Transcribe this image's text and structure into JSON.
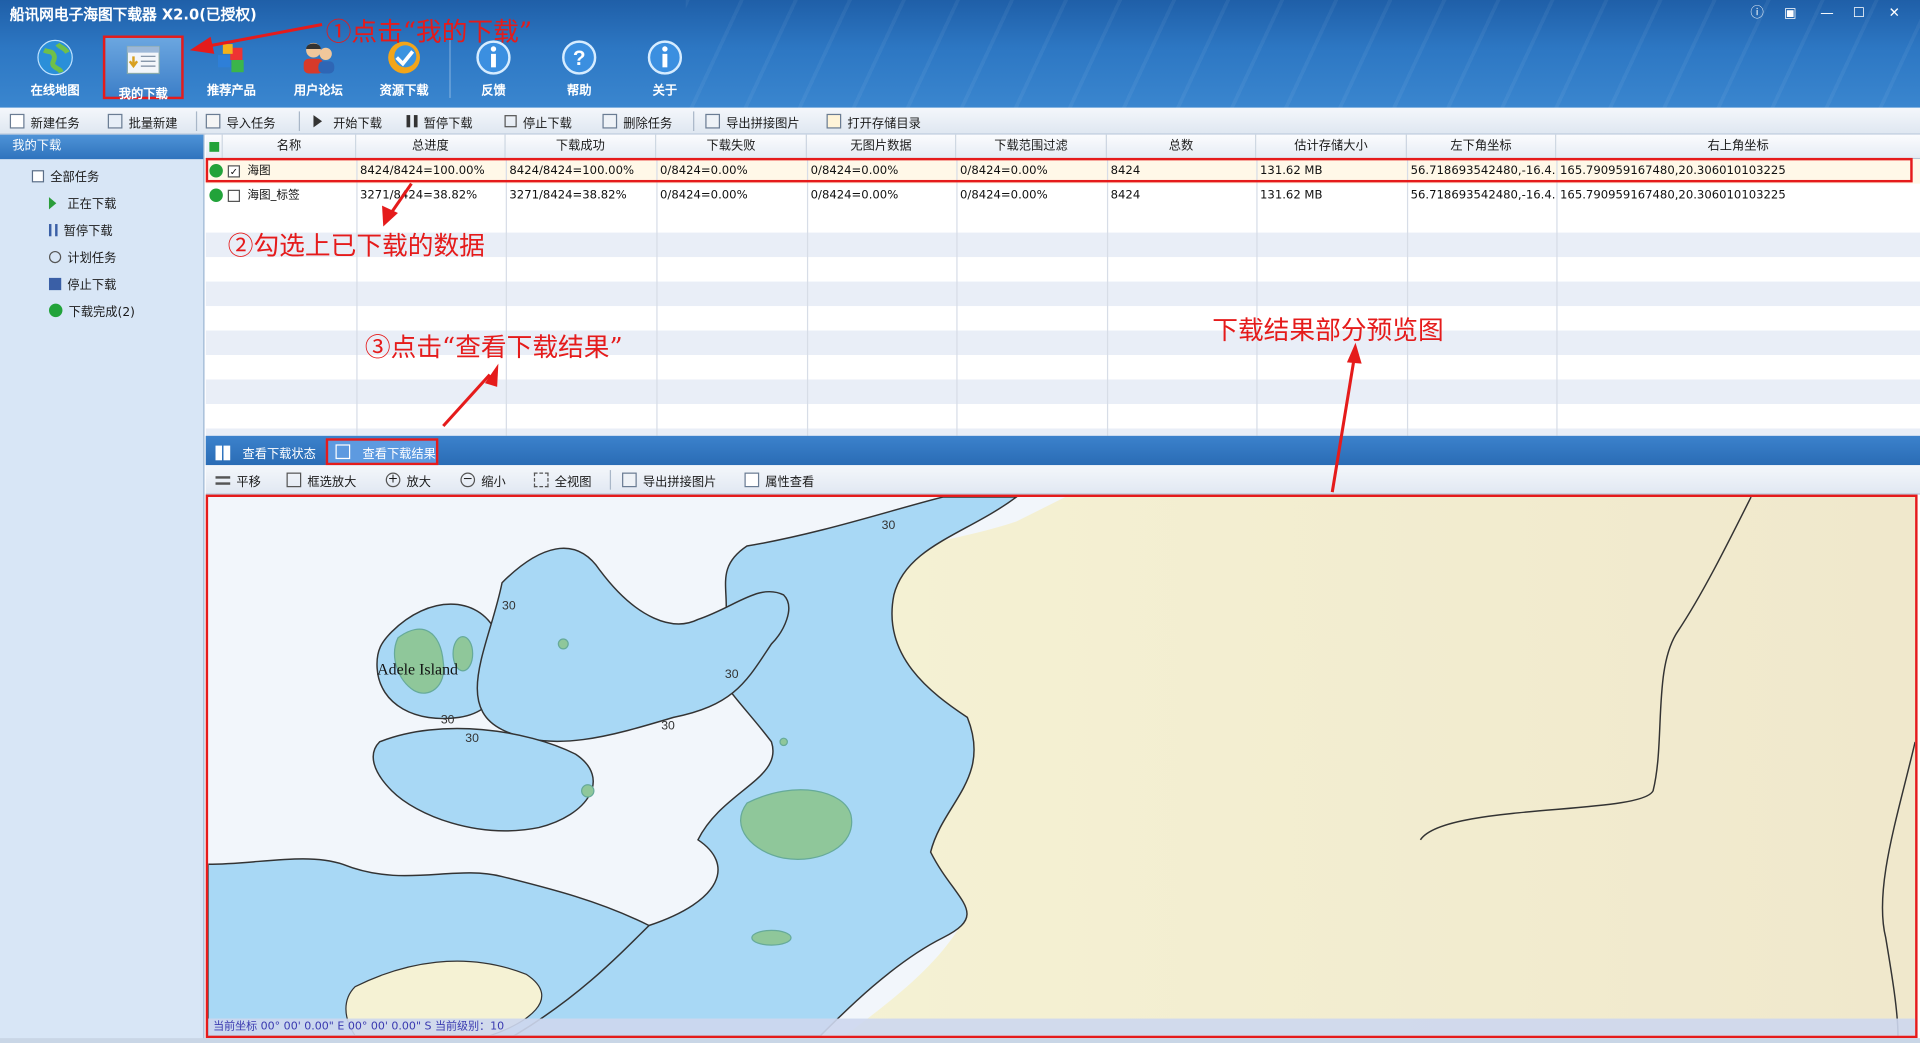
{
  "app": {
    "title": "船讯网电子海图下载器 X2.0(已授权)"
  },
  "window_controls": [
    "ⓘ",
    "▣",
    "—",
    "☐",
    "✕"
  ],
  "main_tools": [
    {
      "label": "在线地图",
      "icon": "globe-icon"
    },
    {
      "label": "我的下载",
      "icon": "download-list-icon"
    },
    {
      "label": "推荐产品",
      "icon": "cubes-icon"
    },
    {
      "label": "用户论坛",
      "icon": "users-icon"
    },
    {
      "label": "资源下载",
      "icon": "resource-icon"
    },
    {
      "label": "反馈",
      "icon": "info-icon"
    },
    {
      "label": "帮助",
      "icon": "help-icon"
    },
    {
      "label": "关于",
      "icon": "info-icon"
    }
  ],
  "toolbar": {
    "new_task": "新建任务",
    "batch_new": "批量新建",
    "import_task": "导入任务",
    "start_download": "开始下载",
    "pause_download": "暂停下载",
    "stop_download": "停止下载",
    "delete_task": "删除任务",
    "export_stitch": "导出拼接图片",
    "open_storage": "打开存储目录"
  },
  "sidebar": {
    "title": "我的下载",
    "root": "全部任务",
    "items": [
      {
        "label": "正在下载",
        "icon": "play-icon"
      },
      {
        "label": "暂停下载",
        "icon": "pause-icon"
      },
      {
        "label": "计划任务",
        "icon": "clock-icon"
      },
      {
        "label": "停止下载",
        "icon": "stop-icon"
      },
      {
        "label": "下载完成(2)",
        "icon": "check-circle-icon"
      }
    ]
  },
  "table": {
    "columns": [
      "名称",
      "总进度",
      "下载成功",
      "下载失败",
      "无图片数据",
      "下载范围过滤",
      "总数",
      "估计存储大小",
      "左下角坐标",
      "右上角坐标"
    ],
    "rows": [
      {
        "name": "海图",
        "checked": true,
        "cells": [
          "8424/8424=100.00%",
          "8424/8424=100.00%",
          "0/8424=0.00%",
          "0/8424=0.00%",
          "0/8424=0.00%",
          "8424",
          "131.62 MB",
          "56.718693542480,-16.4...",
          "165.790959167480,20.306010103225"
        ]
      },
      {
        "name": "海图_标签",
        "checked": false,
        "cells": [
          "3271/8424=38.82%",
          "3271/8424=38.82%",
          "0/8424=0.00%",
          "0/8424=0.00%",
          "0/8424=0.00%",
          "8424",
          "131.62 MB",
          "56.718693542480,-16.4...",
          "165.790959167480,20.306010103225"
        ]
      }
    ]
  },
  "tabs": {
    "status": "查看下载状态",
    "result": "查看下载结果"
  },
  "map_toolbar": {
    "pan": "平移",
    "box_zoom": "框选放大",
    "zoom_in": "放大",
    "zoom_out": "缩小",
    "full_view": "全视图",
    "export_stitch": "导出拼接图片",
    "properties": "属性查看"
  },
  "map": {
    "island_label": "Adele Island",
    "depth_labels": [
      "30",
      "30",
      "30",
      "30",
      "30",
      "30"
    ],
    "status": "当前坐标    00° 00' 0.00\" E 00° 00' 0.00\" S   当前级别：10"
  },
  "annotations": {
    "step1": "①点击“我的下载”",
    "step2": "②勾选上已下载的数据",
    "step3": "③点击“查看下载结果”",
    "preview": "下载结果部分预览图"
  },
  "colors": {
    "accent_red": "#e51b1b",
    "header_blue": "#2d77c3",
    "sea": "#a8d8f5",
    "land": "#f4efc9"
  }
}
